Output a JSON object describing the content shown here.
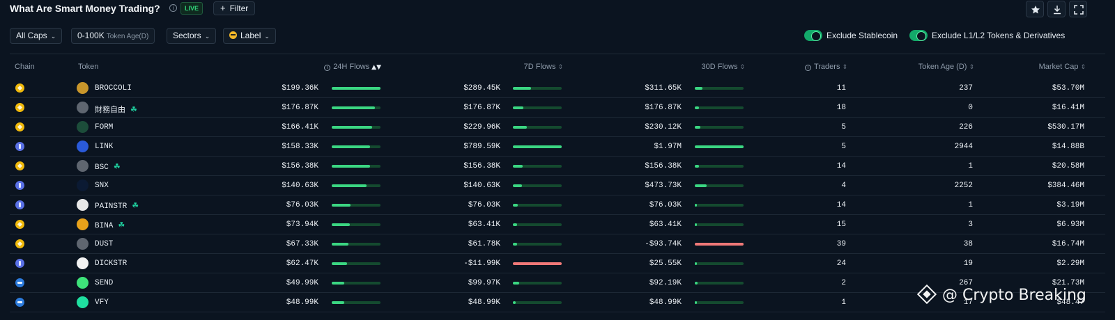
{
  "header": {
    "title": "What Are Smart Money Trading?",
    "info_icon": "i",
    "live_label": "LIVE",
    "filter_label": "Filter",
    "filter_plus": "+",
    "icons": [
      "star-icon",
      "download-icon",
      "fullscreen-icon"
    ]
  },
  "filters": {
    "caps": {
      "label": "All Caps",
      "chevron": "⌄"
    },
    "age": {
      "label": "0-100K",
      "sub": "Token Age(D)"
    },
    "sectors": {
      "label": "Sectors",
      "chevron": "⌄"
    },
    "label_chip": {
      "label": "Label",
      "chevron": "⌄"
    },
    "toggles": [
      {
        "label": "Exclude Stablecoin",
        "on": true
      },
      {
        "label": "Exclude L1/L2 Tokens & Derivatives",
        "on": true
      }
    ]
  },
  "columns": {
    "chain": "Chain",
    "token": "Token",
    "flows_24h": "24H Flows",
    "flows_7d": "7D Flows",
    "flows_30d": "30D Flows",
    "traders": "Traders",
    "token_age": "Token Age (D)",
    "market_cap": "Market Cap",
    "sort_active": "▲▼",
    "sort_idle": "⇕"
  },
  "rows": [
    {
      "chain": "bsc",
      "token": "BROCCOLI",
      "icon_color": "#c9962b",
      "new": false,
      "f24": "$199.36K",
      "f24_bar": 1.0,
      "f7": "$289.45K",
      "f7_bar": 0.37,
      "f30": "$311.65K",
      "f30_bar": 0.16,
      "traders": "11",
      "age": "237",
      "mcap": "$53.70M"
    },
    {
      "chain": "bsc",
      "token": "財務自由",
      "icon_color": "#5f6670",
      "new": true,
      "f24": "$176.87K",
      "f24_bar": 0.89,
      "f7": "$176.87K",
      "f7_bar": 0.22,
      "f30": "$176.87K",
      "f30_bar": 0.09,
      "traders": "18",
      "age": "0",
      "mcap": "$16.41M"
    },
    {
      "chain": "bsc",
      "token": "FORM",
      "icon_color": "#1c4d3a",
      "new": false,
      "f24": "$166.41K",
      "f24_bar": 0.83,
      "f7": "$229.96K",
      "f7_bar": 0.29,
      "f30": "$230.12K",
      "f30_bar": 0.12,
      "traders": "5",
      "age": "226",
      "mcap": "$530.17M"
    },
    {
      "chain": "eth",
      "token": "LINK",
      "icon_color": "#2a5ada",
      "new": false,
      "f24": "$158.33K",
      "f24_bar": 0.79,
      "f7": "$789.59K",
      "f7_bar": 1.0,
      "f30": "$1.97M",
      "f30_bar": 1.0,
      "traders": "5",
      "age": "2944",
      "mcap": "$14.88B"
    },
    {
      "chain": "bsc",
      "token": "BSC",
      "icon_color": "#5f6670",
      "new": true,
      "f24": "$156.38K",
      "f24_bar": 0.78,
      "f7": "$156.38K",
      "f7_bar": 0.2,
      "f30": "$156.38K",
      "f30_bar": 0.08,
      "traders": "14",
      "age": "1",
      "mcap": "$20.58M"
    },
    {
      "chain": "eth",
      "token": "SNX",
      "icon_color": "#0b1a33",
      "new": false,
      "f24": "$140.63K",
      "f24_bar": 0.71,
      "f7": "$140.63K",
      "f7_bar": 0.18,
      "f30": "$473.73K",
      "f30_bar": 0.24,
      "traders": "4",
      "age": "2252",
      "mcap": "$384.46M"
    },
    {
      "chain": "eth",
      "token": "PAINSTR",
      "icon_color": "#e8e8e8",
      "new": true,
      "f24": "$76.03K",
      "f24_bar": 0.38,
      "f7": "$76.03K",
      "f7_bar": 0.1,
      "f30": "$76.03K",
      "f30_bar": 0.04,
      "traders": "14",
      "age": "1",
      "mcap": "$3.19M"
    },
    {
      "chain": "bsc",
      "token": "BINA",
      "icon_color": "#e8a21a",
      "new": true,
      "f24": "$73.94K",
      "f24_bar": 0.37,
      "f7": "$63.41K",
      "f7_bar": 0.08,
      "f30": "$63.41K",
      "f30_bar": 0.03,
      "traders": "15",
      "age": "3",
      "mcap": "$6.93M"
    },
    {
      "chain": "bsc",
      "token": "DUST",
      "icon_color": "#5f6670",
      "new": false,
      "f24": "$67.33K",
      "f24_bar": 0.34,
      "f7": "$61.78K",
      "f7_bar": 0.08,
      "f30": "-$93.74K",
      "f30_bar": 1.0,
      "f30_neg": true,
      "traders": "39",
      "age": "38",
      "mcap": "$16.74M"
    },
    {
      "chain": "eth",
      "token": "DICKSTR",
      "icon_color": "#f2f2f2",
      "new": false,
      "f24": "$62.47K",
      "f24_bar": 0.31,
      "f7": "-$11.99K",
      "f7_bar": 1.0,
      "f7_neg": true,
      "f30": "$25.55K",
      "f30_bar": 0.02,
      "traders": "24",
      "age": "19",
      "mcap": "$2.29M"
    },
    {
      "chain": "sol",
      "token": "SEND",
      "icon_color": "#3ee37a",
      "new": false,
      "f24": "$49.99K",
      "f24_bar": 0.25,
      "f7": "$99.97K",
      "f7_bar": 0.13,
      "f30": "$92.19K",
      "f30_bar": 0.05,
      "traders": "2",
      "age": "267",
      "mcap": "$21.73M"
    },
    {
      "chain": "sol",
      "token": "VFY",
      "icon_color": "#1fe0a0",
      "new": false,
      "f24": "$48.99K",
      "f24_bar": 0.25,
      "f7": "$48.99K",
      "f7_bar": 0.06,
      "f30": "$48.99K",
      "f30_bar": 0.02,
      "traders": "1",
      "age": "17",
      "mcap": "$48.47"
    }
  ],
  "watermark": "@ Crypto Breaking"
}
